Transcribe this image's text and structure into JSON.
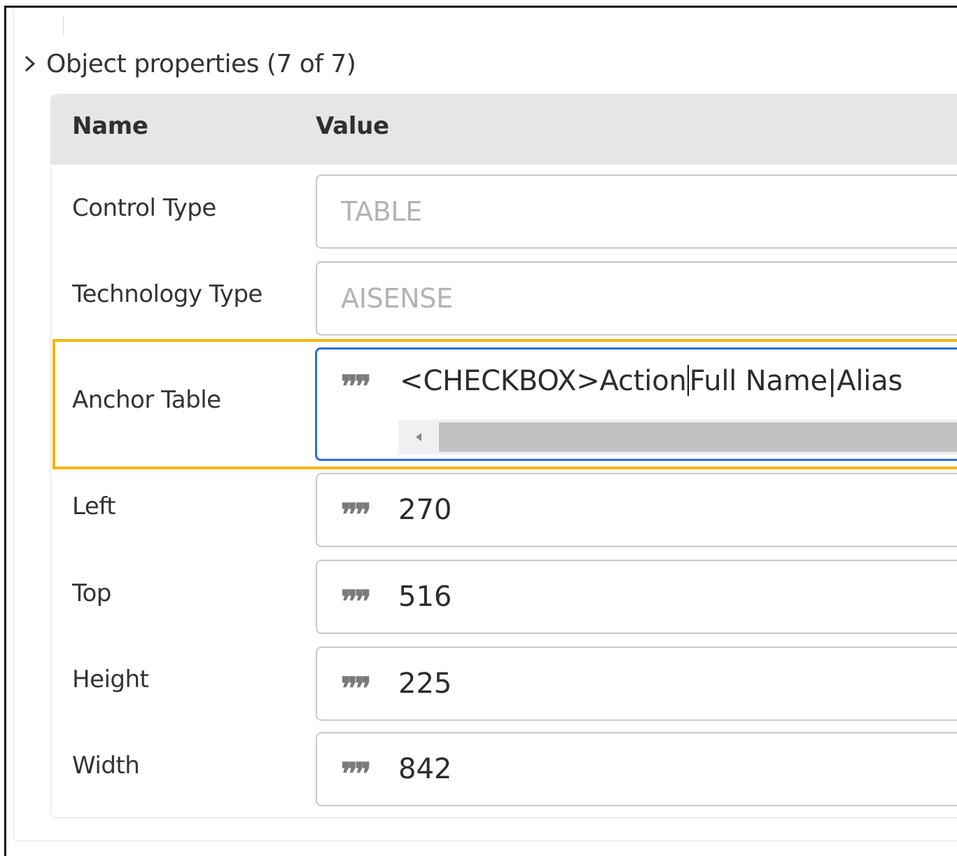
{
  "section": {
    "title": "Object properties (7 of 7)",
    "chevron_icon": "chevron-right-icon"
  },
  "table": {
    "headers": {
      "name": "Name",
      "value": "Value"
    },
    "rows": [
      {
        "name": "Control Type",
        "value": "TABLE",
        "readonly": true
      },
      {
        "name": "Technology Type",
        "value": "AISENSE",
        "readonly": true
      },
      {
        "name": "Anchor Table",
        "value_before_caret": "<CHECKBOX>Action",
        "value_after_caret": "Full Name|Alias",
        "icon": "quote-icon"
      },
      {
        "name": "Left",
        "value": "270",
        "icon": "quote-icon"
      },
      {
        "name": "Top",
        "value": "516",
        "icon": "quote-icon"
      },
      {
        "name": "Height",
        "value": "225",
        "icon": "quote-icon"
      },
      {
        "name": "Width",
        "value": "842",
        "icon": "quote-icon"
      }
    ]
  },
  "colors": {
    "highlight": "#f5b70a",
    "focus": "#2b6fd6",
    "header_bg": "#e6e6e6"
  }
}
